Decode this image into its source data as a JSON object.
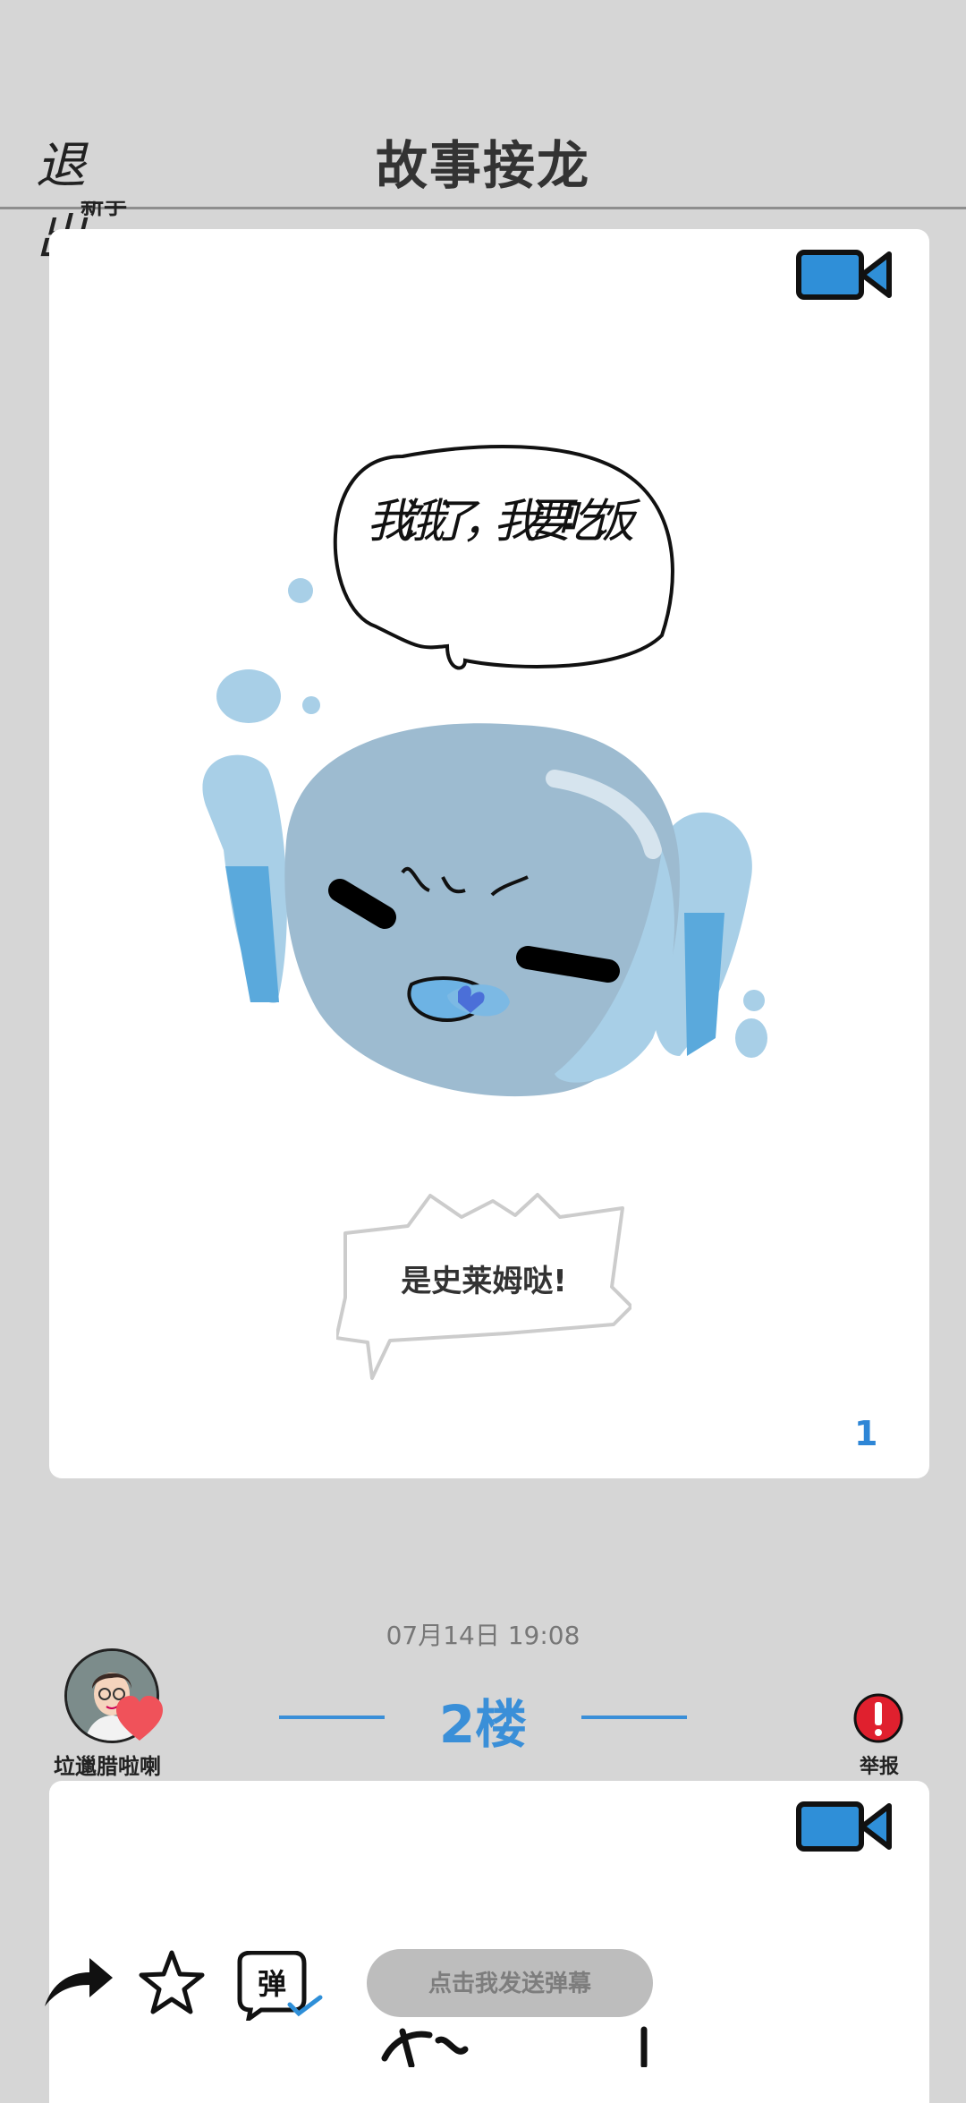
{
  "header": {
    "exit_label": "退 出",
    "title": "故事接龙",
    "cut_text": "新手"
  },
  "post1": {
    "speech_bubble_text": "是史莱姆哒!",
    "handwritten_text": "我饿了，我要吃饭",
    "page_number": "1"
  },
  "post2": {
    "timestamp": "07月14日  19:08",
    "floor_label": "2楼",
    "username": "垃邋腊啦喇",
    "report_label": "举报"
  },
  "toolbar": {
    "send_danmaku_placeholder": "点击我发送弹幕",
    "danmaku_icon_text": "弹"
  },
  "colors": {
    "accent_blue": "#3a8fd8",
    "report_red": "#e0202e",
    "background": "#d6d6d6"
  }
}
